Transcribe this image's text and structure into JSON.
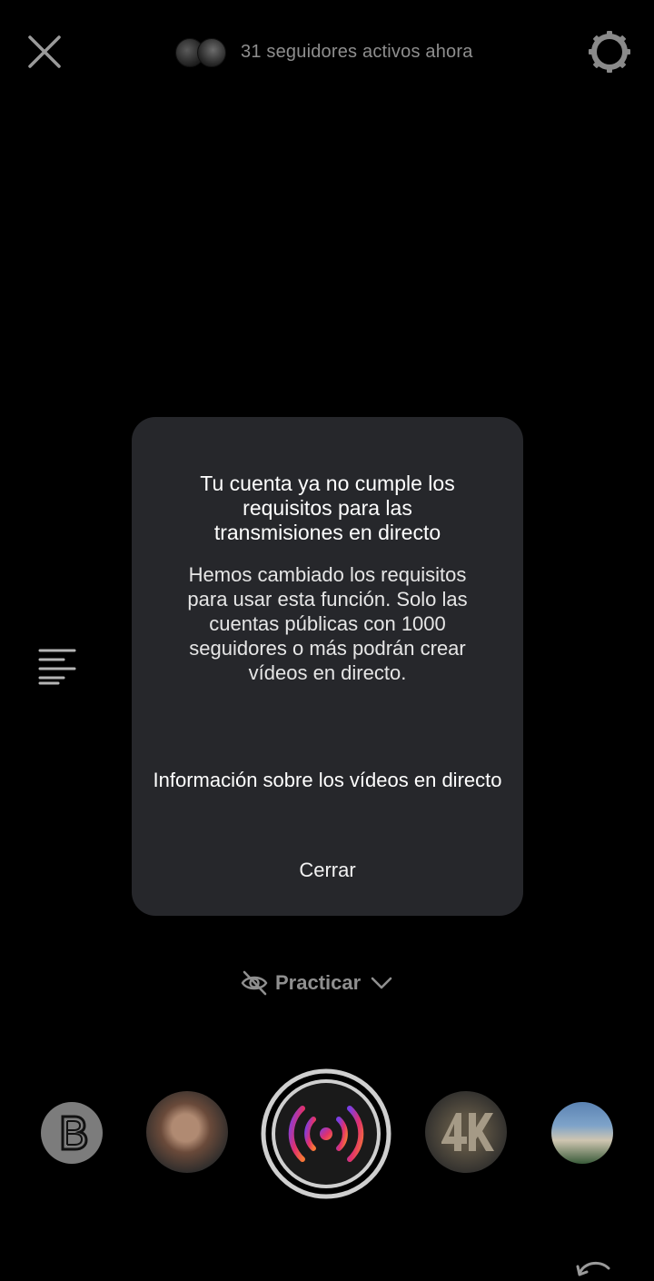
{
  "header": {
    "viewers_text": "31 seguidores activos ahora",
    "close_icon": "close-icon",
    "settings_icon": "gear-icon"
  },
  "dialog": {
    "title": "Tu cuenta ya no cumple los requisitos para las transmisiones en directo",
    "body": "Hemos cambiado los requisitos para usar esta función. Solo las cuentas públicas con 1000 seguidores o más podrán crear vídeos en directo.",
    "link_label": "Información sobre los vídeos en directo",
    "close_label": "Cerrar"
  },
  "practice": {
    "label": "Practicar",
    "icon": "eye-off-icon",
    "chevron": "chevron-down-icon"
  },
  "effects": [
    {
      "name": "effect-b",
      "icon": "letter-b-icon"
    },
    {
      "name": "effect-portrait"
    },
    {
      "name": "live-record",
      "icon": "live-broadcast-icon"
    },
    {
      "name": "effect-4k"
    },
    {
      "name": "effect-beach"
    }
  ],
  "colors": {
    "background": "#000000",
    "dialog": "#26272b",
    "muted_text": "#8e8e8e",
    "live_gradient": [
      "#7b3fe4",
      "#e1306c",
      "#f77737"
    ]
  }
}
